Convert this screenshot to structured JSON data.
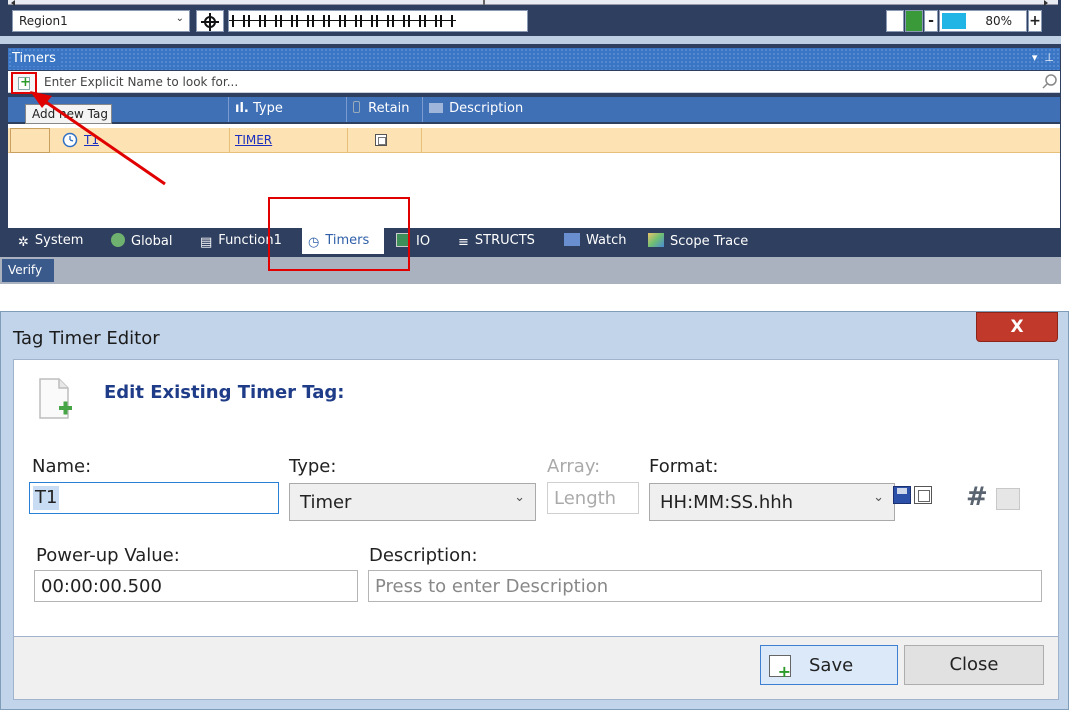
{
  "toolbar": {
    "region_select": "Region1",
    "zoom_level": "80%",
    "zoom_fraction": 0.8,
    "zoom_minus": "-",
    "zoom_plus": "+"
  },
  "timers_panel": {
    "title": "Timers",
    "search_placeholder": "Enter Explicit Name to look for...",
    "add_tooltip": "Add new Tag",
    "columns": [
      "Type",
      "Retain",
      "Description"
    ],
    "rows": [
      {
        "name": "T1",
        "type": "TIMER",
        "retain": false,
        "description": ""
      }
    ]
  },
  "bottom_tabs": [
    {
      "label": "System",
      "icon": "gear-icon"
    },
    {
      "label": "Global",
      "icon": "globe-icon"
    },
    {
      "label": "Function1",
      "icon": "film-icon"
    },
    {
      "label": "Timers",
      "icon": "clock-icon",
      "active": true
    },
    {
      "label": "IO",
      "icon": "io-icon"
    },
    {
      "label": "STRUCTS",
      "icon": "stack-icon"
    },
    {
      "label": "Watch",
      "icon": "watch-icon"
    },
    {
      "label": "Scope Trace",
      "icon": "scope-icon"
    }
  ],
  "status_bar": {
    "verify_label": "Verify"
  },
  "dialog": {
    "title": "Tag Timer Editor",
    "close_glyph": "X",
    "heading": "Edit Existing Timer Tag:",
    "name_label": "Name:",
    "name_value": "T1",
    "type_label": "Type:",
    "type_value": "Timer",
    "array_label": "Array:",
    "array_placeholder": "Length",
    "format_label": "Format:",
    "format_value": "HH:MM:SS.hhh",
    "powerup_label": "Power-up Value:",
    "powerup_value": "00:00:00.500",
    "description_label": "Description:",
    "description_placeholder": "Press to enter Description",
    "save_label": "Save",
    "close_label": "Close"
  },
  "colors": {
    "accent": "#3b76c4",
    "highlight_row": "#fde3b3",
    "annotation_red": "#e00000",
    "zoom_fill": "#21b5e6"
  }
}
